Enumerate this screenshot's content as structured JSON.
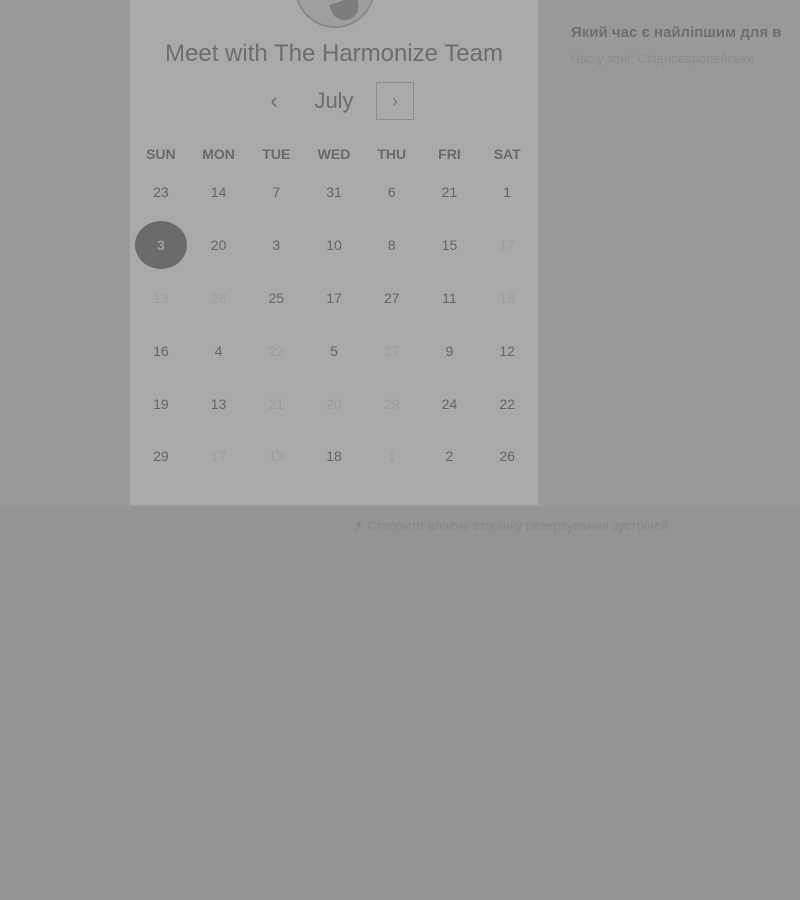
{
  "header": {
    "title": "Meet with The Harmonize Team"
  },
  "calendar": {
    "month": "July",
    "prev_icon": "chevron-left-icon",
    "next_icon": "chevron-right-icon",
    "weekdays": [
      "SUN",
      "MON",
      "TUE",
      "WED",
      "THU",
      "FRI",
      "SAT"
    ],
    "weeks": [
      [
        {
          "d": "23"
        },
        {
          "d": "14"
        },
        {
          "d": "7"
        },
        {
          "d": "31"
        },
        {
          "d": "6"
        },
        {
          "d": "21"
        },
        {
          "d": "1"
        }
      ],
      [
        {
          "d": "3",
          "selected": true
        },
        {
          "d": "20"
        },
        {
          "d": "3"
        },
        {
          "d": "10"
        },
        {
          "d": "8"
        },
        {
          "d": "15"
        },
        {
          "d": "17",
          "muted": true
        }
      ],
      [
        {
          "d": "13",
          "muted": true
        },
        {
          "d": "28",
          "muted": true
        },
        {
          "d": "25"
        },
        {
          "d": "17"
        },
        {
          "d": "27"
        },
        {
          "d": "11"
        },
        {
          "d": "18",
          "muted": true
        }
      ],
      [
        {
          "d": "16"
        },
        {
          "d": "4"
        },
        {
          "d": "22",
          "muted": true
        },
        {
          "d": "5"
        },
        {
          "d": "27",
          "muted": true
        },
        {
          "d": "9"
        },
        {
          "d": "12"
        }
      ],
      [
        {
          "d": "19"
        },
        {
          "d": "13"
        },
        {
          "d": "21",
          "muted": true
        },
        {
          "d": "20",
          "muted": true
        },
        {
          "d": "29",
          "muted": true
        },
        {
          "d": "24"
        },
        {
          "d": "22"
        }
      ],
      [
        {
          "d": "29"
        },
        {
          "d": "17",
          "muted": true
        },
        {
          "d": "13",
          "muted": true
        },
        {
          "d": "18"
        },
        {
          "d": "1",
          "muted": true
        },
        {
          "d": "2"
        },
        {
          "d": "26"
        }
      ]
    ]
  },
  "right_panel": {
    "heading": "Який час є найліпшим для в",
    "subtitle": "Час у зоні: Східноєвропейськи"
  },
  "time_slots": [
    "",
    "",
    "",
    "",
    "",
    "",
    ""
  ],
  "footer": {
    "link_text": "Створити власну сторінку резервування зустрічей"
  }
}
